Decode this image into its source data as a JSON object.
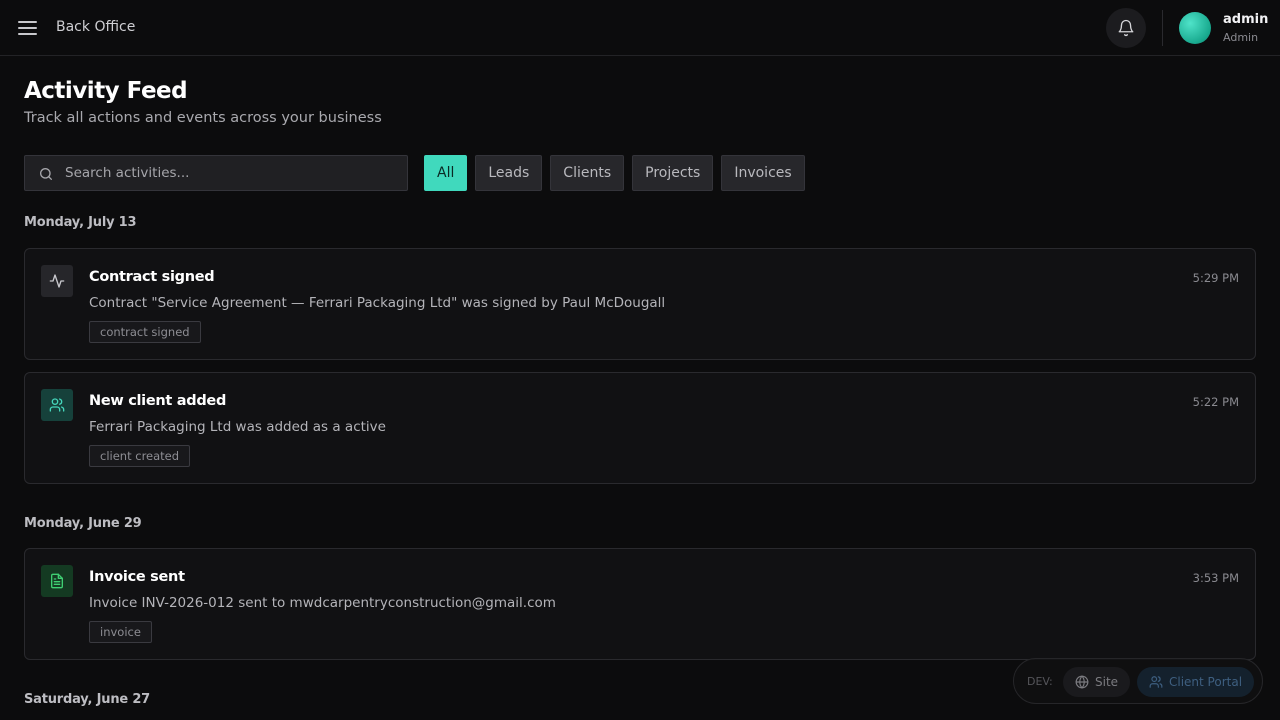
{
  "header": {
    "menu_icon": "hamburger-menu-icon",
    "app_title": "Back Office",
    "notifications_icon": "bell-icon",
    "user": {
      "name": "admin",
      "role": "Admin"
    }
  },
  "page": {
    "title": "Activity Feed",
    "subtitle": "Track all actions and events across your business"
  },
  "search": {
    "placeholder": "Search activities...",
    "value": "",
    "icon": "search-icon"
  },
  "filters": [
    {
      "label": "All",
      "active": true
    },
    {
      "label": "Leads",
      "active": false
    },
    {
      "label": "Clients",
      "active": false
    },
    {
      "label": "Projects",
      "active": false
    },
    {
      "label": "Invoices",
      "active": false
    }
  ],
  "groups": [
    {
      "date": "Monday, July 13",
      "items": [
        {
          "icon": "activity-pulse-icon",
          "title": "Contract signed",
          "description": "Contract \"Service Agreement — Ferrari Packaging Ltd\" was signed by Paul McDougall",
          "tag": "contract signed",
          "time": "5:29 PM"
        },
        {
          "icon": "users-icon",
          "title": "New client added",
          "description": "Ferrari Packaging Ltd was added as a active",
          "tag": "client created",
          "time": "5:22 PM"
        }
      ]
    },
    {
      "date": "Monday, June 29",
      "items": [
        {
          "icon": "document-icon",
          "title": "Invoice sent",
          "description": "Invoice INV-2026-012 sent to mwdcarpentryconstruction@gmail.com",
          "tag": "invoice",
          "time": "3:53 PM"
        }
      ]
    },
    {
      "date": "Saturday, June 27",
      "items": []
    }
  ],
  "devbar": {
    "label": "DEV:",
    "site_label": "Site",
    "site_icon": "globe-icon",
    "portal_label": "Client Portal",
    "portal_icon": "users-icon"
  },
  "colors": {
    "accent": "#40d9bd",
    "background": "#0c0c0d",
    "card": "#111113"
  }
}
